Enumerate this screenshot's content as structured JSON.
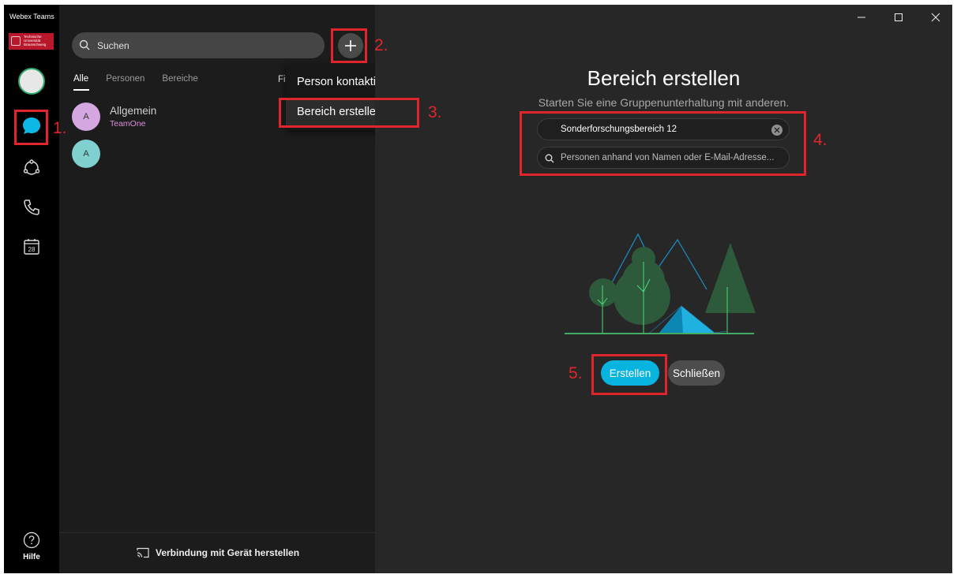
{
  "app": {
    "title": "Webex Teams",
    "logo_text": "Technische\nUniversität\nBraunschweig"
  },
  "rail": {
    "help_label": "Hilfe",
    "calendar_day": "28"
  },
  "search": {
    "placeholder": "Suchen"
  },
  "tabs": [
    {
      "label": "Alle",
      "active": true
    },
    {
      "label": "Personen",
      "active": false
    },
    {
      "label": "Bereiche",
      "active": false
    }
  ],
  "filter_label": "Fil",
  "spaces": [
    {
      "initial": "A",
      "title": "Allgemein",
      "subtitle": "TeamOne",
      "color": "#d5a7e0"
    },
    {
      "initial": "A",
      "title": "",
      "subtitle": "",
      "color": "#7fd0ce"
    }
  ],
  "footer": {
    "connect_label": "Verbindung mit Gerät herstellen"
  },
  "dropdown": {
    "items": [
      "Person kontaktieren",
      "Bereich erstellen"
    ],
    "selected": "Bereich erstellen"
  },
  "create_space": {
    "title": "Bereich erstellen",
    "subtitle": "Starten Sie eine Gruppenunterhaltung mit anderen.",
    "name_value": "Sonderforschungsbereich 12",
    "people_placeholder": "Personen anhand von Namen oder E-Mail-Adresse...",
    "create_label": "Erstellen",
    "close_label": "Schließen"
  },
  "annotations": [
    "1.",
    "2.",
    "3.",
    "4.",
    "5."
  ],
  "colors": {
    "accent": "#07b3df",
    "annotation": "#e1252c",
    "presence": "#2ca86c"
  }
}
